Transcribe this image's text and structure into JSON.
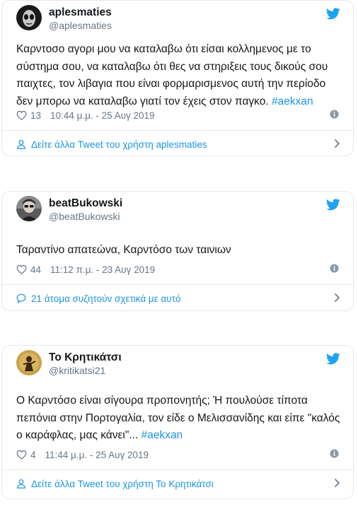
{
  "tweets": [
    {
      "name": "aplesmaties",
      "handle": "@aplesmaties",
      "text": "Καρντοσο αγορι μου να καταλαβω ότι είσαι κολλημενος με το σύστημα σου, να καταλαβω ότι θες να στηριξεις τους δικούς σου παιχτες, τον λιβαγια που είναι φορμαρισμενος αυτή την περίοδο δεν μπορω να καταλαβω γιατί τον έχεις στον παγκο.",
      "hashtag": "#aekxan",
      "likes": "13",
      "timestamp": "10:44 μ.μ. - 25 Αυγ 2019",
      "footer": "Δείτε άλλα Tweet του χρήστη aplesmaties"
    },
    {
      "name": "beatBukowski",
      "handle": "@beatBukowski",
      "text": "Ταραντίνο απατεώνα, Καρντόσο των ταινιων",
      "likes": "44",
      "timestamp": "11:12 π.μ. - 23 Αυγ 2019",
      "footer": "21 άτομα συζητούν σχετικά με αυτό"
    },
    {
      "name": "Το Κρητικάτσι",
      "handle": "@kritikatsi21",
      "text": "Ο Καρντόσο είναι σίγουρα προπονητής; Ή πουλούσε τίποτα πεπόνια στην Πορτογαλία, τον είδε ο Μελισσανίδης και είπε \"καλός ο καράφλας, μας κάνει\"...",
      "hashtag": "#aekxan",
      "likes": "4",
      "timestamp": "11:44 μ.μ. - 25 Αυγ 2019",
      "footer": "Δείτε άλλα Tweet του χρήστη Το Κρητικάτσι"
    }
  ],
  "icons": {
    "bird": "twitter-bird-icon",
    "heart": "heart-icon",
    "info": "info-icon",
    "person": "person-icon",
    "reply": "speech-bubble-icon",
    "chevron": "chevron-right-icon"
  },
  "colors": {
    "accent": "#1b95e0",
    "bird": "#1da1f2",
    "muted": "#657786",
    "border": "#e1e8ed"
  }
}
